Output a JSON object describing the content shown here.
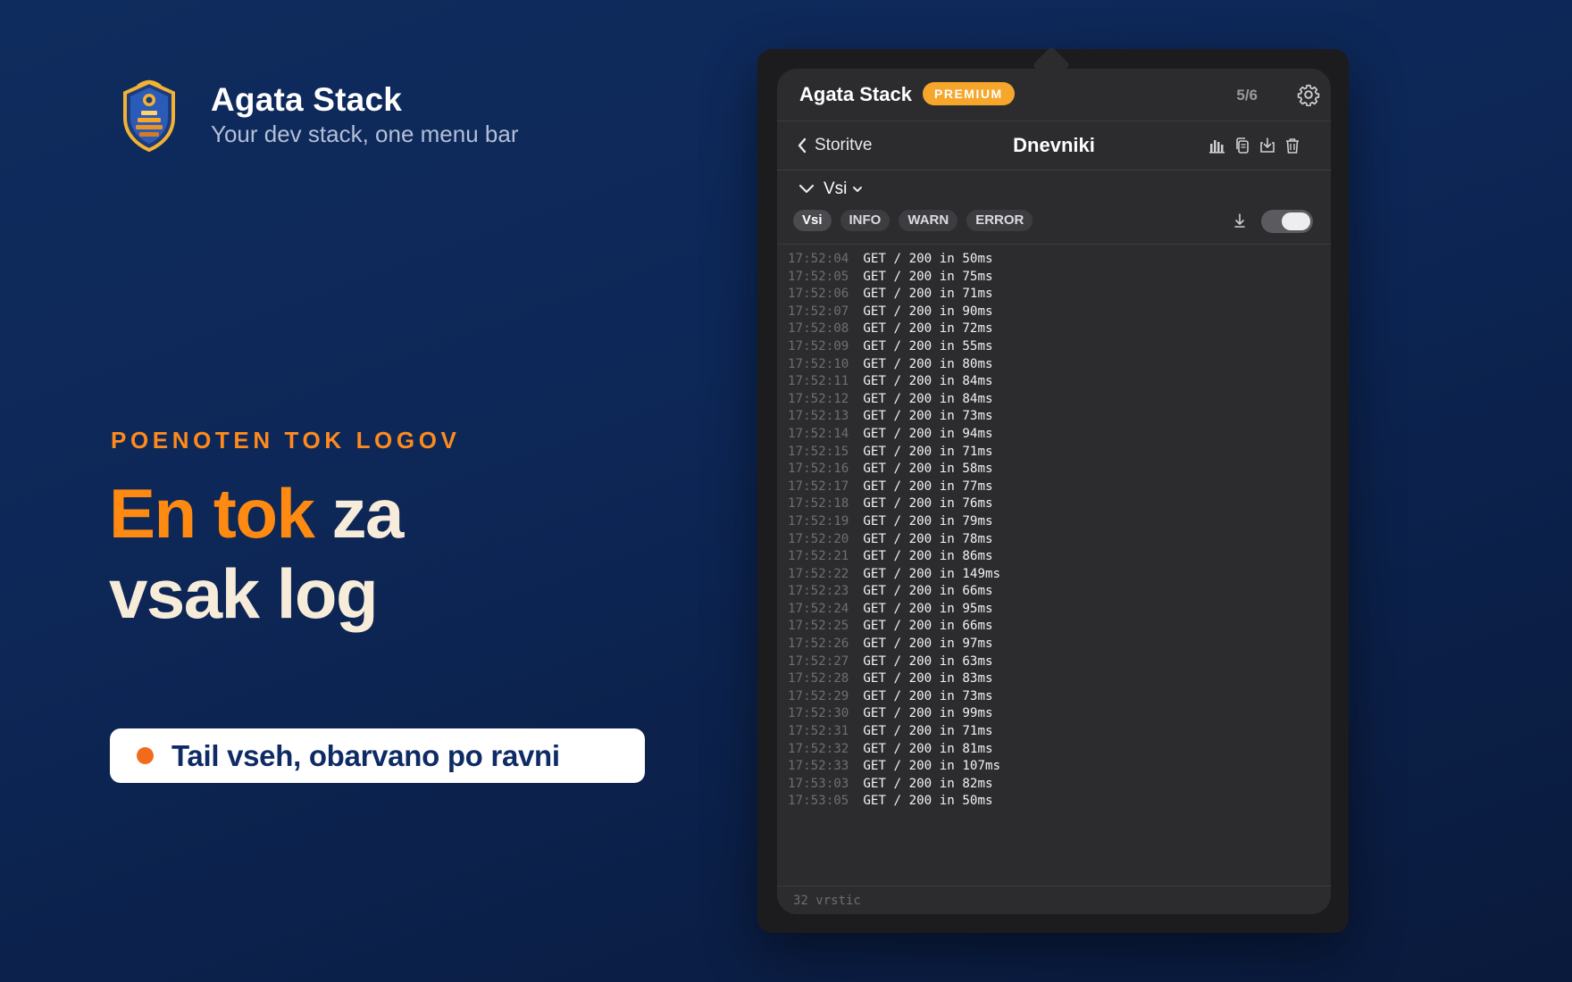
{
  "brand": {
    "title": "Agata Stack",
    "tagline": "Your dev stack, one menu bar",
    "logo_icon": "shield-stack-logo"
  },
  "hero": {
    "eyebrow": "POENOTEN TOK LOGOV",
    "headline_accent": "En tok",
    "headline_rest_1": " za",
    "headline_line2": "vsak log",
    "feature_pill": "Tail vseh, obarvano po ravni"
  },
  "colors": {
    "accent_orange": "#ff8a12",
    "premium_badge": "#f6a62b",
    "background_navy": "#0d2757",
    "panel_dark": "#2c2c2e"
  },
  "app": {
    "title": "Agata Stack",
    "badge": "PREMIUM",
    "counter": "5/6",
    "settings_icon": "gear-icon",
    "nav": {
      "back_label": "Storitve",
      "title": "Dnevniki",
      "actions": [
        "chart-icon",
        "copy-icon",
        "export-icon",
        "trash-icon"
      ]
    },
    "source_selector": "Vsi",
    "levels": [
      "Vsi",
      "INFO",
      "WARN",
      "ERROR"
    ],
    "active_level": "Vsi",
    "autoscroll_icon": "download-arrow-icon",
    "follow_toggle_on": true,
    "logs": [
      {
        "ts": "17:52:04",
        "msg": "GET / 200 in 50ms"
      },
      {
        "ts": "17:52:05",
        "msg": "GET / 200 in 75ms"
      },
      {
        "ts": "17:52:06",
        "msg": "GET / 200 in 71ms"
      },
      {
        "ts": "17:52:07",
        "msg": "GET / 200 in 90ms"
      },
      {
        "ts": "17:52:08",
        "msg": "GET / 200 in 72ms"
      },
      {
        "ts": "17:52:09",
        "msg": "GET / 200 in 55ms"
      },
      {
        "ts": "17:52:10",
        "msg": "GET / 200 in 80ms"
      },
      {
        "ts": "17:52:11",
        "msg": "GET / 200 in 84ms"
      },
      {
        "ts": "17:52:12",
        "msg": "GET / 200 in 84ms"
      },
      {
        "ts": "17:52:13",
        "msg": "GET / 200 in 73ms"
      },
      {
        "ts": "17:52:14",
        "msg": "GET / 200 in 94ms"
      },
      {
        "ts": "17:52:15",
        "msg": "GET / 200 in 71ms"
      },
      {
        "ts": "17:52:16",
        "msg": "GET / 200 in 58ms"
      },
      {
        "ts": "17:52:17",
        "msg": "GET / 200 in 77ms"
      },
      {
        "ts": "17:52:18",
        "msg": "GET / 200 in 76ms"
      },
      {
        "ts": "17:52:19",
        "msg": "GET / 200 in 79ms"
      },
      {
        "ts": "17:52:20",
        "msg": "GET / 200 in 78ms"
      },
      {
        "ts": "17:52:21",
        "msg": "GET / 200 in 86ms"
      },
      {
        "ts": "17:52:22",
        "msg": "GET / 200 in 149ms"
      },
      {
        "ts": "17:52:23",
        "msg": "GET / 200 in 66ms"
      },
      {
        "ts": "17:52:24",
        "msg": "GET / 200 in 95ms"
      },
      {
        "ts": "17:52:25",
        "msg": "GET / 200 in 66ms"
      },
      {
        "ts": "17:52:26",
        "msg": "GET / 200 in 97ms"
      },
      {
        "ts": "17:52:27",
        "msg": "GET / 200 in 63ms"
      },
      {
        "ts": "17:52:28",
        "msg": "GET / 200 in 83ms"
      },
      {
        "ts": "17:52:29",
        "msg": "GET / 200 in 73ms"
      },
      {
        "ts": "17:52:30",
        "msg": "GET / 200 in 99ms"
      },
      {
        "ts": "17:52:31",
        "msg": "GET / 200 in 71ms"
      },
      {
        "ts": "17:52:32",
        "msg": "GET / 200 in 81ms"
      },
      {
        "ts": "17:52:33",
        "msg": "GET / 200 in 107ms"
      },
      {
        "ts": "17:53:03",
        "msg": "GET / 200 in 82ms"
      },
      {
        "ts": "17:53:05",
        "msg": "GET / 200 in 50ms"
      }
    ],
    "footer": "32 vrstic"
  }
}
